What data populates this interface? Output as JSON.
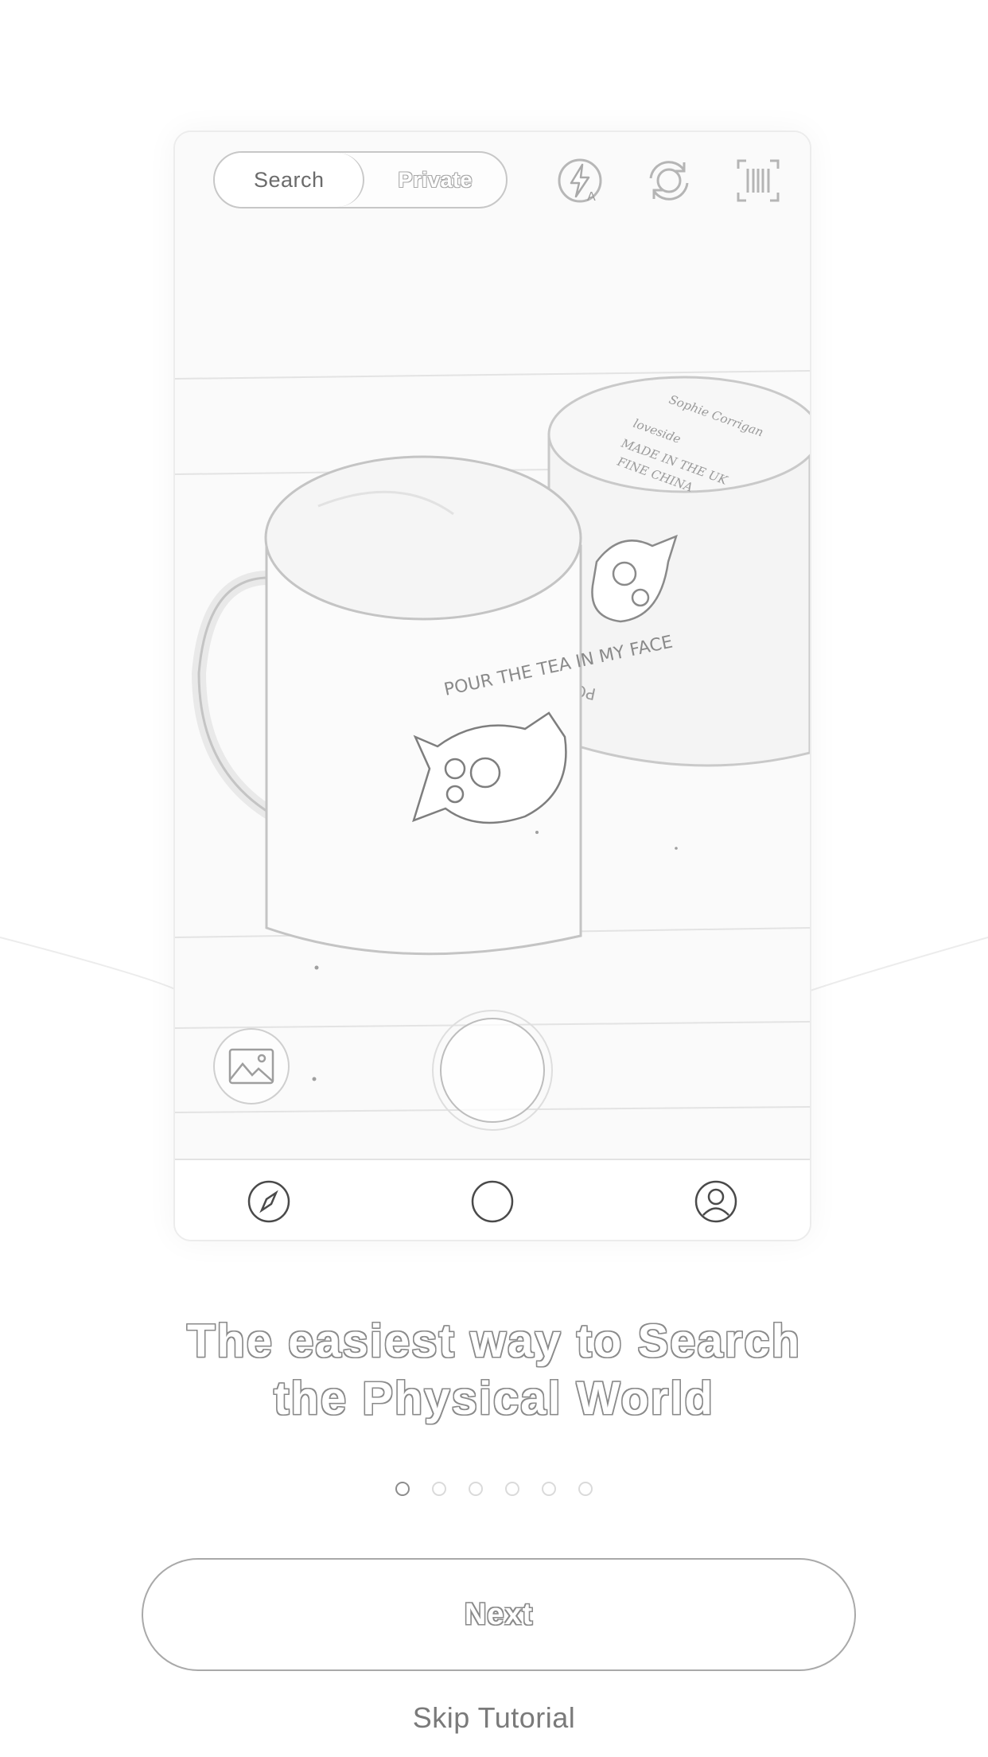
{
  "camera": {
    "mode_toggle": {
      "active": "Search",
      "inactive": "Private"
    },
    "top_icons": [
      "flash-auto-icon",
      "switch-camera-icon",
      "barcode-scan-icon"
    ],
    "bottom_controls": [
      "gallery-icon",
      "shutter-button"
    ]
  },
  "scene_text": {
    "mug_front": "POUR THE TEA IN MY FACE",
    "mug_back": "POUR"
  },
  "tabbar": {
    "items": [
      "compass-icon",
      "camera-tab-icon",
      "profile-icon"
    ]
  },
  "onboarding": {
    "headline": "The easiest way to Search\nthe Physical World",
    "page_count": 6,
    "current_page": 1,
    "next_label": "Next",
    "skip_label": "Skip Tutorial"
  }
}
